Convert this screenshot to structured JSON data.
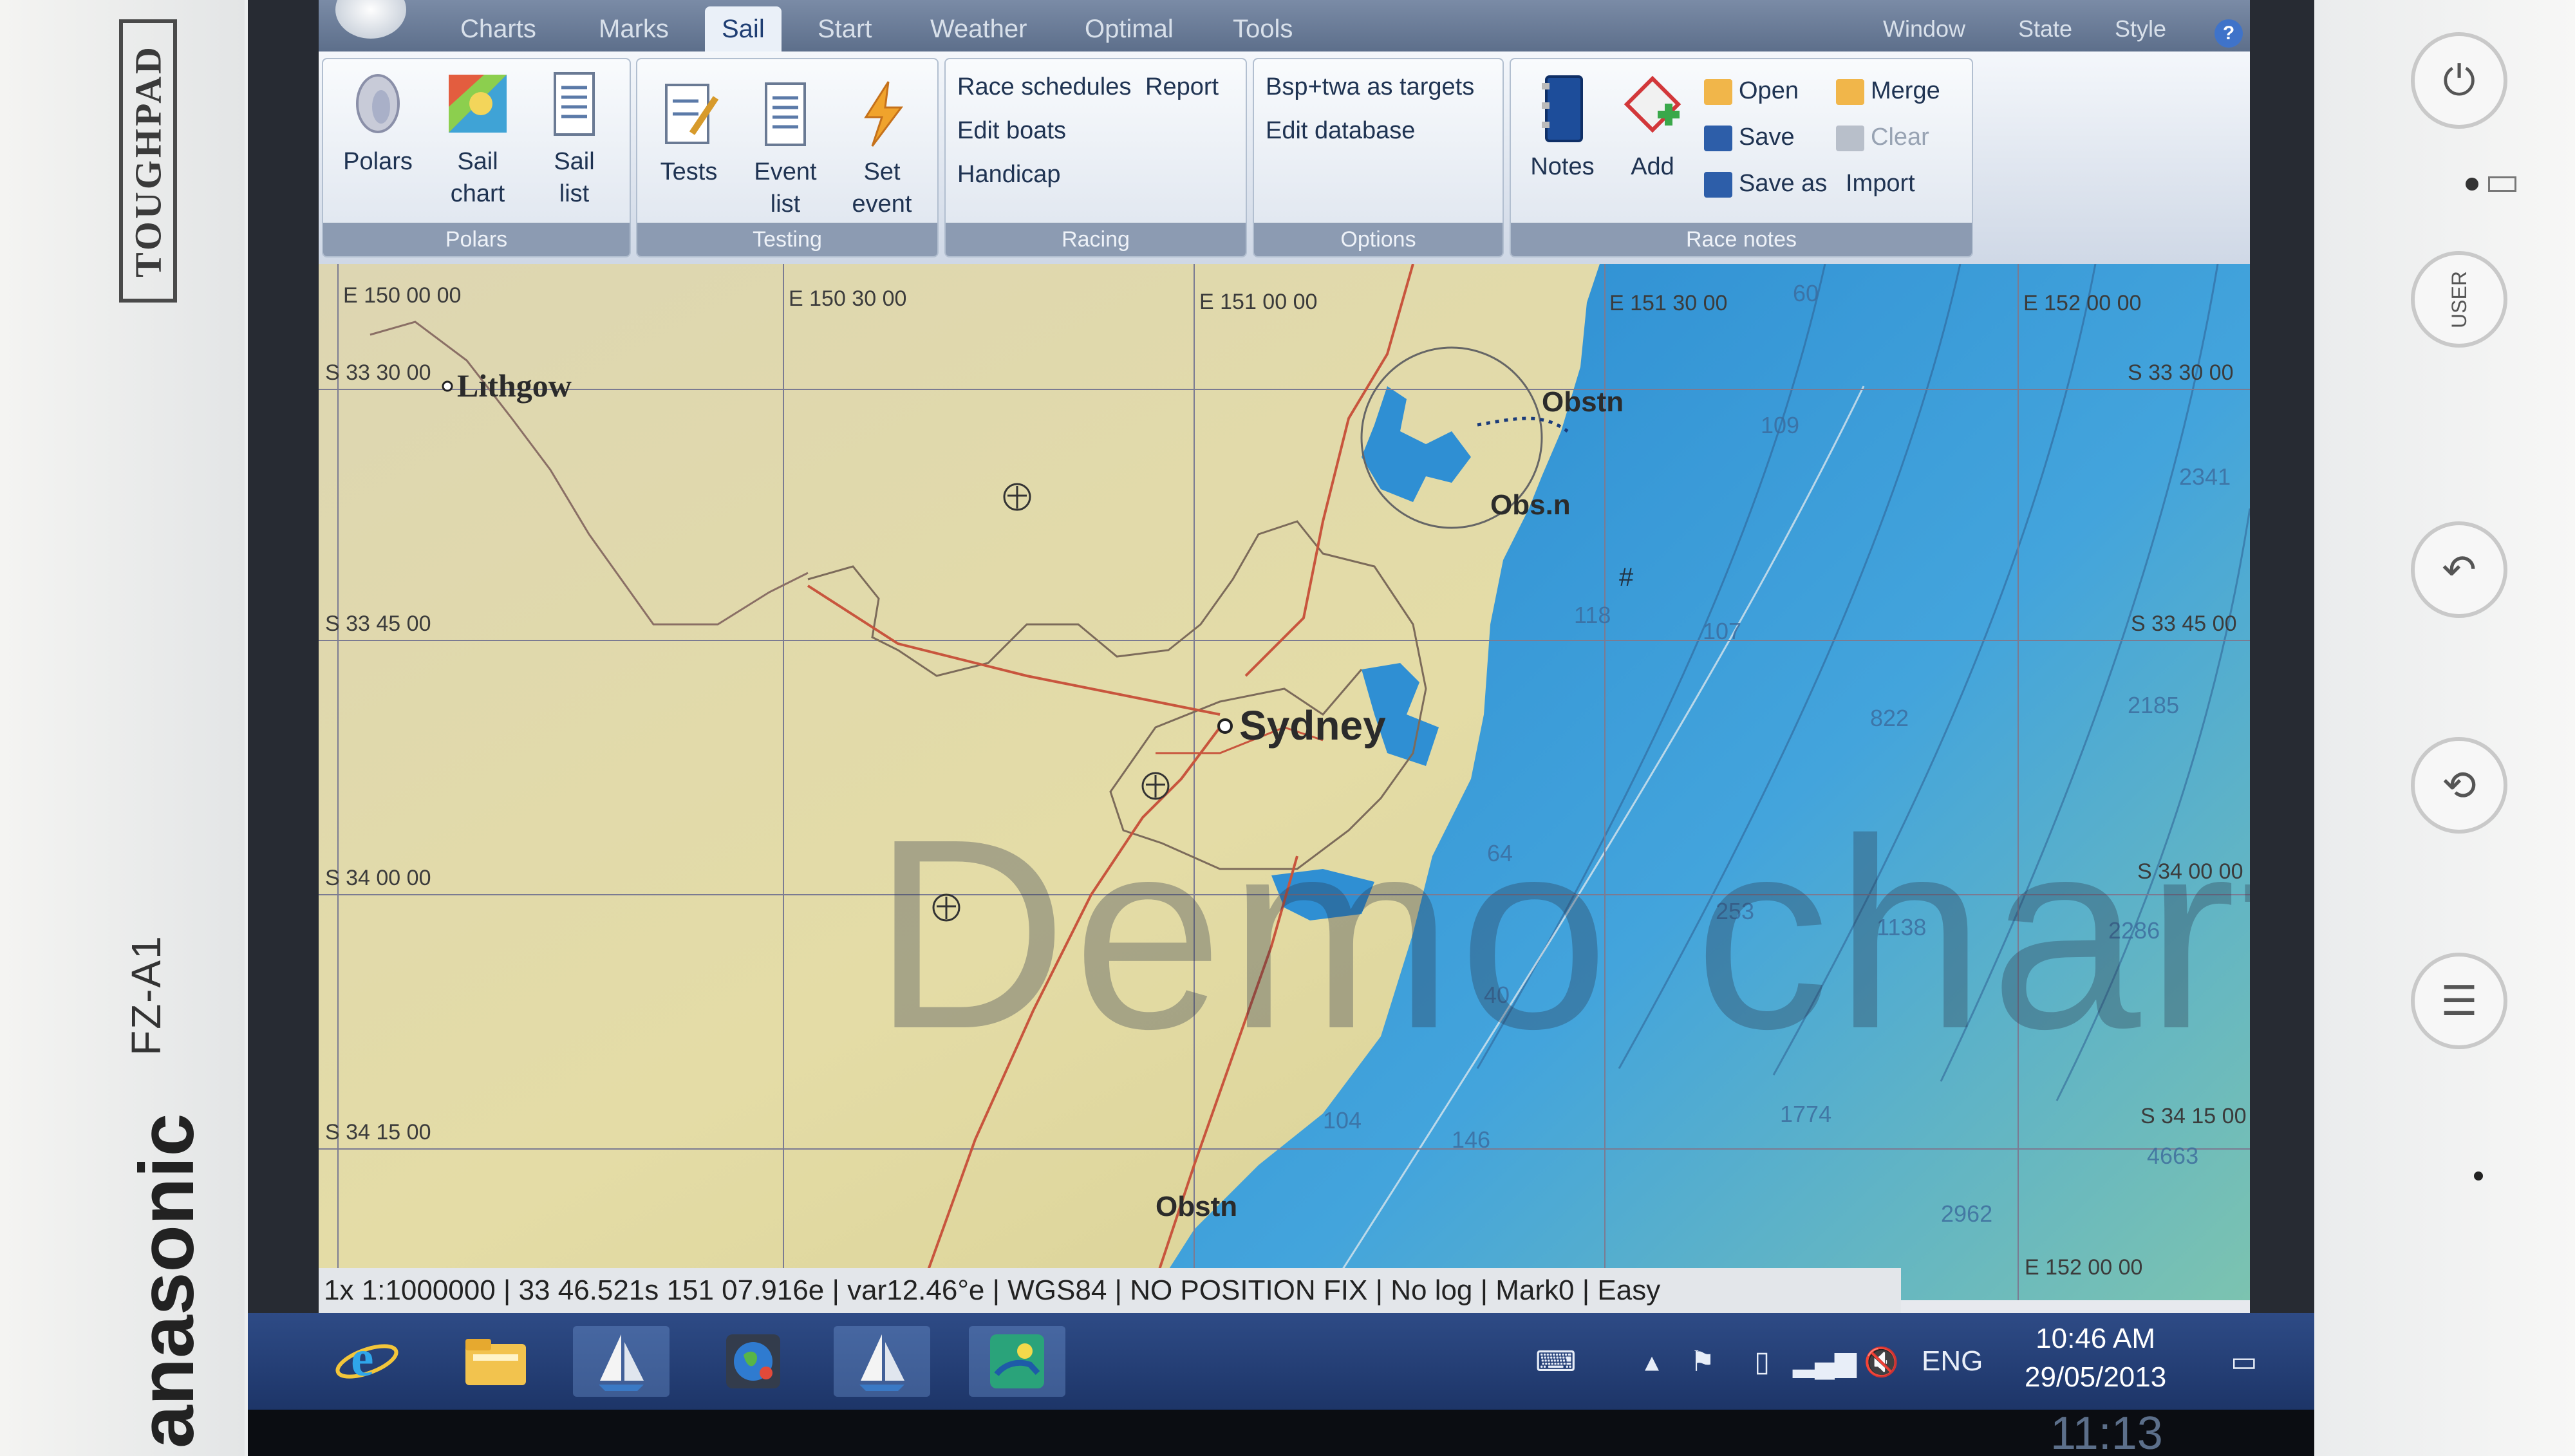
{
  "device": {
    "series": "TOUGHPAD",
    "model": "FZ-A1",
    "maker": "anasonic"
  },
  "ribbon": {
    "tabs": [
      "Charts",
      "Marks",
      "Sail",
      "Start",
      "Weather",
      "Optimal",
      "Tools"
    ],
    "active_tab": "Sail",
    "right_menus": [
      "Window",
      "State",
      "Style"
    ],
    "groups": {
      "polars": {
        "label": "Polars",
        "polars": "Polars",
        "sail_chart": [
          "Sail",
          "chart"
        ],
        "sail_list": [
          "Sail",
          "list"
        ]
      },
      "testing": {
        "label": "Testing",
        "tests": "Tests",
        "event_list": [
          "Event",
          "list"
        ],
        "set_event": [
          "Set",
          "event"
        ]
      },
      "racing": {
        "label": "Racing",
        "race_schedules": "Race schedules",
        "report": "Report",
        "edit_boats": "Edit boats",
        "handicap": "Handicap"
      },
      "options": {
        "label": "Options",
        "bsp_twa": "Bsp+twa as targets",
        "edit_database": "Edit database"
      },
      "race_notes": {
        "label": "Race notes",
        "notes": "Notes",
        "add": "Add",
        "open": "Open",
        "merge": "Merge",
        "save": "Save",
        "clear": "Clear",
        "save_as": "Save as",
        "import": "Import"
      }
    }
  },
  "map": {
    "longitudes": [
      "E 150 00 00",
      "E 150 30 00",
      "E 151 00 00",
      "E 151 30 00",
      "E 152 00 00"
    ],
    "latitudes_left": [
      "S 33 30 00",
      "S 33 45 00",
      "S 34 00 00",
      "S 34 15 00"
    ],
    "latitudes_right": [
      "S 33 30 00",
      "S 33 45 00",
      "S 34 00 00",
      "S 34 15 00"
    ],
    "bottom_right_lon": "E 152 00 00",
    "places": {
      "lithgow": "Lithgow",
      "sydney": "Sydney",
      "obstn_1": "Obstn",
      "obstn_2": "Obs.n",
      "obstn_3": "Obstn"
    },
    "depths": [
      "109",
      "2341",
      "118",
      "107",
      "822",
      "2185",
      "64",
      "253",
      "1138",
      "2286",
      "40",
      "104",
      "146",
      "1774",
      "4663",
      "2962",
      "60"
    ],
    "watermark": "Demo charts"
  },
  "status_bar": "1x 1:1000000 | 33 46.521s 151 07.916e | var12.46°e | WGS84 | NO POSITION FIX | No log | Mark0 | Easy",
  "taskbar": {
    "language": "ENG",
    "time": "10:46 AM",
    "date": "29/05/2013"
  },
  "android": {
    "time": "11:13"
  },
  "colors": {
    "land": "#d9d2a5",
    "sea_deep": "#2a86cc",
    "sea_shallow": "#53b7e6",
    "road": "#c8553d",
    "ribbon_active": "#1f3e73"
  }
}
